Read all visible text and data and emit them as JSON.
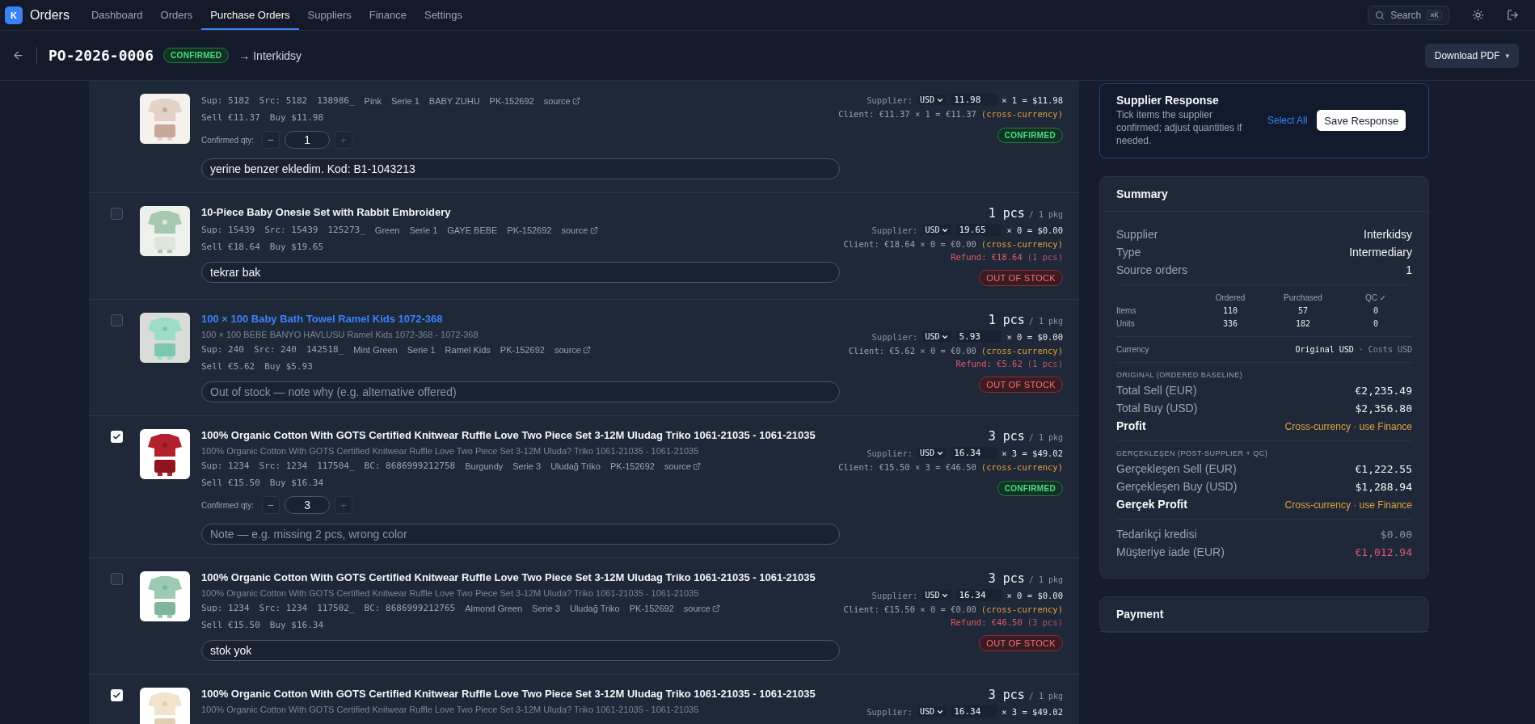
{
  "app": {
    "logo": "K",
    "name": "Orders"
  },
  "nav": [
    {
      "label": "Dashboard",
      "selected": false
    },
    {
      "label": "Orders",
      "selected": false
    },
    {
      "label": "Purchase Orders",
      "selected": true
    },
    {
      "label": "Suppliers",
      "selected": false
    },
    {
      "label": "Finance",
      "selected": false
    },
    {
      "label": "Settings",
      "selected": false
    }
  ],
  "search": {
    "label": "Search",
    "shortcut": "⌘K"
  },
  "header": {
    "po": "PO-2026-0006",
    "status": "CONFIRMED",
    "supplier": "→ Interkidsy",
    "download": "Download PDF",
    "caret": "▾"
  },
  "items": [
    {
      "meta": [
        {
          "t": "Sup: 5182",
          "kind": "code"
        },
        {
          "t": "Src: 5182",
          "kind": "code"
        },
        {
          "t": "138986_",
          "kind": "code"
        },
        {
          "t": "Pink",
          "kind": "text"
        },
        {
          "t": "Serie 1",
          "kind": "text"
        },
        {
          "t": "BABY ZUHU",
          "kind": "text"
        },
        {
          "t": "PK-152692",
          "kind": "text"
        },
        {
          "t": "source",
          "kind": "link"
        }
      ],
      "sell": "Sell €11.37",
      "buy": "Buy $11.98",
      "confirmed_qty": {
        "label": "Confirmed qty:",
        "minus": "−",
        "value": "1",
        "plus": "+"
      },
      "note": {
        "value": "yerine benzer ekledim. Kod: B1-1043213"
      },
      "supplier": {
        "label": "Supplier:",
        "currency": "USD",
        "price": "11.98",
        "calc": "× 1 = $11.98"
      },
      "client": {
        "text": "Client: €11.37 × 1 = €11.37",
        "tag": "(cross-currency)"
      },
      "status": {
        "label": "CONFIRMED",
        "kind": "confirmed"
      }
    },
    {
      "checked": false,
      "title": "10-Piece Baby Onesie Set with Rabbit Embroidery",
      "linked": false,
      "meta": [
        {
          "t": "Sup: 15439",
          "kind": "code"
        },
        {
          "t": "Src: 15439",
          "kind": "code"
        },
        {
          "t": "125273_",
          "kind": "code"
        },
        {
          "t": "Green",
          "kind": "text"
        },
        {
          "t": "Serie 1",
          "kind": "text"
        },
        {
          "t": "GAYE BEBE",
          "kind": "text"
        },
        {
          "t": "PK-152692",
          "kind": "text"
        },
        {
          "t": "source",
          "kind": "link"
        }
      ],
      "sell": "Sell €18.64",
      "buy": "Buy $19.65",
      "note": {
        "value": "tekrar bak"
      },
      "qty": "1 pcs",
      "pkg": "/ 1 pkg",
      "supplier": {
        "label": "Supplier:",
        "currency": "USD",
        "price": "19.65",
        "calc": "× 0 = $0.00"
      },
      "client": {
        "text": "Client: €18.64 × 0 = €0.00",
        "tag": "(cross-currency)"
      },
      "refund": {
        "amount": "Refund: €18.64",
        "count": "(1 pcs)"
      },
      "status": {
        "label": "OUT OF STOCK",
        "kind": "out"
      }
    },
    {
      "checked": false,
      "title": "100 × 100 Baby Bath Towel Ramel Kids 1072-368",
      "linked": true,
      "subtitle": "100 × 100 BEBE BANYO HAVLUSU Ramel Kids 1072-368 - 1072-368",
      "meta": [
        {
          "t": "Sup: 240",
          "kind": "code"
        },
        {
          "t": "Src: 240",
          "kind": "code"
        },
        {
          "t": "142518_",
          "kind": "code"
        },
        {
          "t": "Mint Green",
          "kind": "text"
        },
        {
          "t": "Serie 1",
          "kind": "text"
        },
        {
          "t": "Ramel Kids",
          "kind": "text"
        },
        {
          "t": "PK-152692",
          "kind": "text"
        },
        {
          "t": "source",
          "kind": "link"
        }
      ],
      "sell": "Sell €5.62",
      "buy": "Buy $5.93",
      "note": {
        "placeholder": "Out of stock — note why (e.g. alternative offered)"
      },
      "qty": "1 pcs",
      "pkg": "/ 1 pkg",
      "supplier": {
        "label": "Supplier:",
        "currency": "USD",
        "price": "5.93",
        "calc": "× 0 = $0.00"
      },
      "client": {
        "text": "Client: €5.62 × 0 = €0.00",
        "tag": "(cross-currency)"
      },
      "refund": {
        "amount": "Refund: €5.62",
        "count": "(1 pcs)"
      },
      "status": {
        "label": "OUT OF STOCK",
        "kind": "out"
      }
    },
    {
      "checked": true,
      "title": "100% Organic Cotton With GOTS Certified Knitwear Ruffle Love Two Piece Set 3-12M Uludag Triko 1061-21035 - 1061-21035",
      "linked": false,
      "subtitle": "100% Organic Cotton With GOTS Certified Knitwear Ruffle Love Two Piece Set 3-12M Uluda? Triko 1061-21035 - 1061-21035",
      "meta": [
        {
          "t": "Sup: 1234",
          "kind": "code"
        },
        {
          "t": "Src: 1234",
          "kind": "code"
        },
        {
          "t": "117504_",
          "kind": "code"
        },
        {
          "t": "BC: 8686999212758",
          "kind": "code"
        },
        {
          "t": "Burgundy",
          "kind": "text"
        },
        {
          "t": "Serie 3",
          "kind": "text"
        },
        {
          "t": "Uludağ Triko",
          "kind": "text"
        },
        {
          "t": "PK-152692",
          "kind": "text"
        },
        {
          "t": "source",
          "kind": "link"
        }
      ],
      "sell": "Sell €15.50",
      "buy": "Buy $16.34",
      "confirmed_qty": {
        "label": "Confirmed qty:",
        "minus": "−",
        "value": "3",
        "plus": "+"
      },
      "note": {
        "placeholder": "Note — e.g. missing 2 pcs, wrong color"
      },
      "qty": "3 pcs",
      "pkg": "/ 1 pkg",
      "supplier": {
        "label": "Supplier:",
        "currency": "USD",
        "price": "16.34",
        "calc": "× 3 = $49.02"
      },
      "client": {
        "text": "Client: €15.50 × 3 = €46.50",
        "tag": "(cross-currency)"
      },
      "status": {
        "label": "CONFIRMED",
        "kind": "confirmed"
      }
    },
    {
      "checked": false,
      "title": "100% Organic Cotton With GOTS Certified Knitwear Ruffle Love Two Piece Set 3-12M Uludag Triko 1061-21035 - 1061-21035",
      "linked": false,
      "subtitle": "100% Organic Cotton With GOTS Certified Knitwear Ruffle Love Two Piece Set 3-12M Uluda? Triko 1061-21035 - 1061-21035",
      "meta": [
        {
          "t": "Sup: 1234",
          "kind": "code"
        },
        {
          "t": "Src: 1234",
          "kind": "code"
        },
        {
          "t": "117502_",
          "kind": "code"
        },
        {
          "t": "BC: 8686999212765",
          "kind": "code"
        },
        {
          "t": "Almond Green",
          "kind": "text"
        },
        {
          "t": "Serie 3",
          "kind": "text"
        },
        {
          "t": "Uludağ Triko",
          "kind": "text"
        },
        {
          "t": "PK-152692",
          "kind": "text"
        },
        {
          "t": "source",
          "kind": "link"
        }
      ],
      "sell": "Sell €15.50",
      "buy": "Buy $16.34",
      "note": {
        "value": "stok yok"
      },
      "qty": "3 pcs",
      "pkg": "/ 1 pkg",
      "supplier": {
        "label": "Supplier:",
        "currency": "USD",
        "price": "16.34",
        "calc": "× 0 = $0.00"
      },
      "client": {
        "text": "Client: €15.50 × 0 = €0.00",
        "tag": "(cross-currency)"
      },
      "refund": {
        "amount": "Refund: €46.50",
        "count": "(3 pcs)"
      },
      "status": {
        "label": "OUT OF STOCK",
        "kind": "out"
      }
    },
    {
      "checked": true,
      "title": "100% Organic Cotton With GOTS Certified Knitwear Ruffle Love Two Piece Set 3-12M Uludag Triko 1061-21035 - 1061-21035",
      "linked": false,
      "subtitle": "100% Organic Cotton With GOTS Certified Knitwear Ruffle Love Two Piece Set 3-12M Uluda? Triko 1061-21035 - 1061-21035",
      "qty": "3 pcs",
      "pkg": "/ 1 pkg",
      "supplier": {
        "label": "Supplier:",
        "currency": "USD",
        "price": "16.34",
        "calc": "× 3 = $49.02"
      }
    }
  ],
  "supplier_response": {
    "title": "Supplier Response",
    "description": "Tick items the supplier confirmed; adjust quantities if needed.",
    "select_all": "Select All",
    "save": "Save Response"
  },
  "summary": {
    "title": "Summary",
    "info": [
      {
        "label": "Supplier",
        "value": "Interkidsy"
      },
      {
        "label": "Type",
        "value": "Intermediary"
      },
      {
        "label": "Source orders",
        "value": "1"
      }
    ],
    "counts": {
      "columns": [
        "Ordered",
        "Purchased",
        "QC ✓"
      ],
      "rows": [
        {
          "label": "Items",
          "values": [
            "110",
            "57",
            "0"
          ]
        },
        {
          "label": "Units",
          "values": [
            "336",
            "182",
            "0"
          ]
        }
      ]
    },
    "currency": {
      "label": "Currency",
      "original": "Original USD",
      "separator": "·",
      "costs": "Costs USD"
    },
    "sections": [
      {
        "heading": "ORIGINAL (ORDERED BASELINE)",
        "rows": [
          {
            "label": "Total Sell (EUR)",
            "value": "€2,235.49",
            "kind": "amount"
          },
          {
            "label": "Total Buy (USD)",
            "value": "$2,356.80",
            "kind": "amount"
          },
          {
            "label": "Profit",
            "value": "Cross-currency · use Finance",
            "kind": "warning"
          }
        ]
      },
      {
        "heading": "GERÇEKLEŞEN (POST-SUPPLIER + QC)",
        "rows": [
          {
            "label": "Gerçekleşen Sell (EUR)",
            "value": "€1,222.55",
            "kind": "amount"
          },
          {
            "label": "Gerçekleşen Buy (USD)",
            "value": "$1,288.94",
            "kind": "amount"
          },
          {
            "label": "Gerçek Profit",
            "value": "Cross-currency · use Finance",
            "kind": "warning"
          }
        ]
      },
      {
        "rows": [
          {
            "label": "Tedarikçi kredisi",
            "value": "$0.00",
            "kind": "muted"
          },
          {
            "label": "Müşteriye iade (EUR)",
            "value": "€1,012.94",
            "kind": "danger"
          }
        ]
      }
    ]
  },
  "payment": {
    "title": "Payment"
  }
}
